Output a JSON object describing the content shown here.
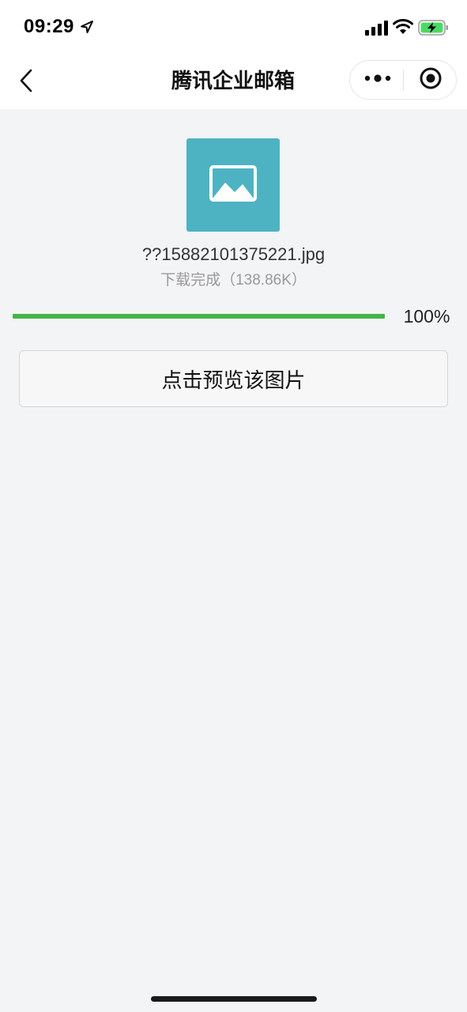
{
  "status_bar": {
    "time": "09:29",
    "icons": [
      "location-arrow-icon",
      "cellular-signal-icon",
      "wifi-icon",
      "battery-charging-icon"
    ],
    "battery_color": "#4cd964"
  },
  "nav_bar": {
    "title": "腾讯企业邮箱",
    "back_icon": "chevron-left-icon",
    "more_icon": "more-dots-icon",
    "close_icon": "target-circle-icon"
  },
  "file": {
    "icon": "image-icon",
    "icon_bg_color": "#4db3c3",
    "name": "??15882101375221.jpg",
    "status": "下载完成（138.86K）"
  },
  "progress": {
    "percent_value": 100,
    "percent_label": "100%",
    "fill_color": "#44b549"
  },
  "actions": {
    "preview_label": "点击预览该图片"
  }
}
